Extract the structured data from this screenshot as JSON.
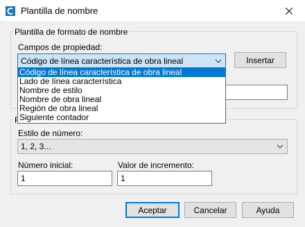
{
  "window": {
    "title": "Plantilla de nombre",
    "icon": "autocad-c-icon"
  },
  "groups": {
    "format": "Plantilla de formato de nombre",
    "numbering": "Fo"
  },
  "property_fields": {
    "label": "Campos de propiedad:",
    "selected": "Código de línea característica de obra lineal",
    "options": [
      "Código de línea característica de obra lineal",
      "Lado de línea característica",
      "Nombre de estilo",
      "Nombre de obra lineal",
      "Región de obra lineal",
      "Siguiente contador"
    ],
    "insert_label": "Insertar"
  },
  "name_value": "",
  "number_style": {
    "label": "Estilo de número:",
    "value": "1, 2, 3..."
  },
  "start_number": {
    "label": "Número inicial:",
    "value": "1"
  },
  "increment": {
    "label": "Valor de incremento:",
    "value": "1"
  },
  "buttons": {
    "ok": "Aceptar",
    "cancel": "Cancelar",
    "help": "Ayuda"
  },
  "colors": {
    "accent": "#0078d7",
    "selection_bg": "#cce4f7"
  }
}
